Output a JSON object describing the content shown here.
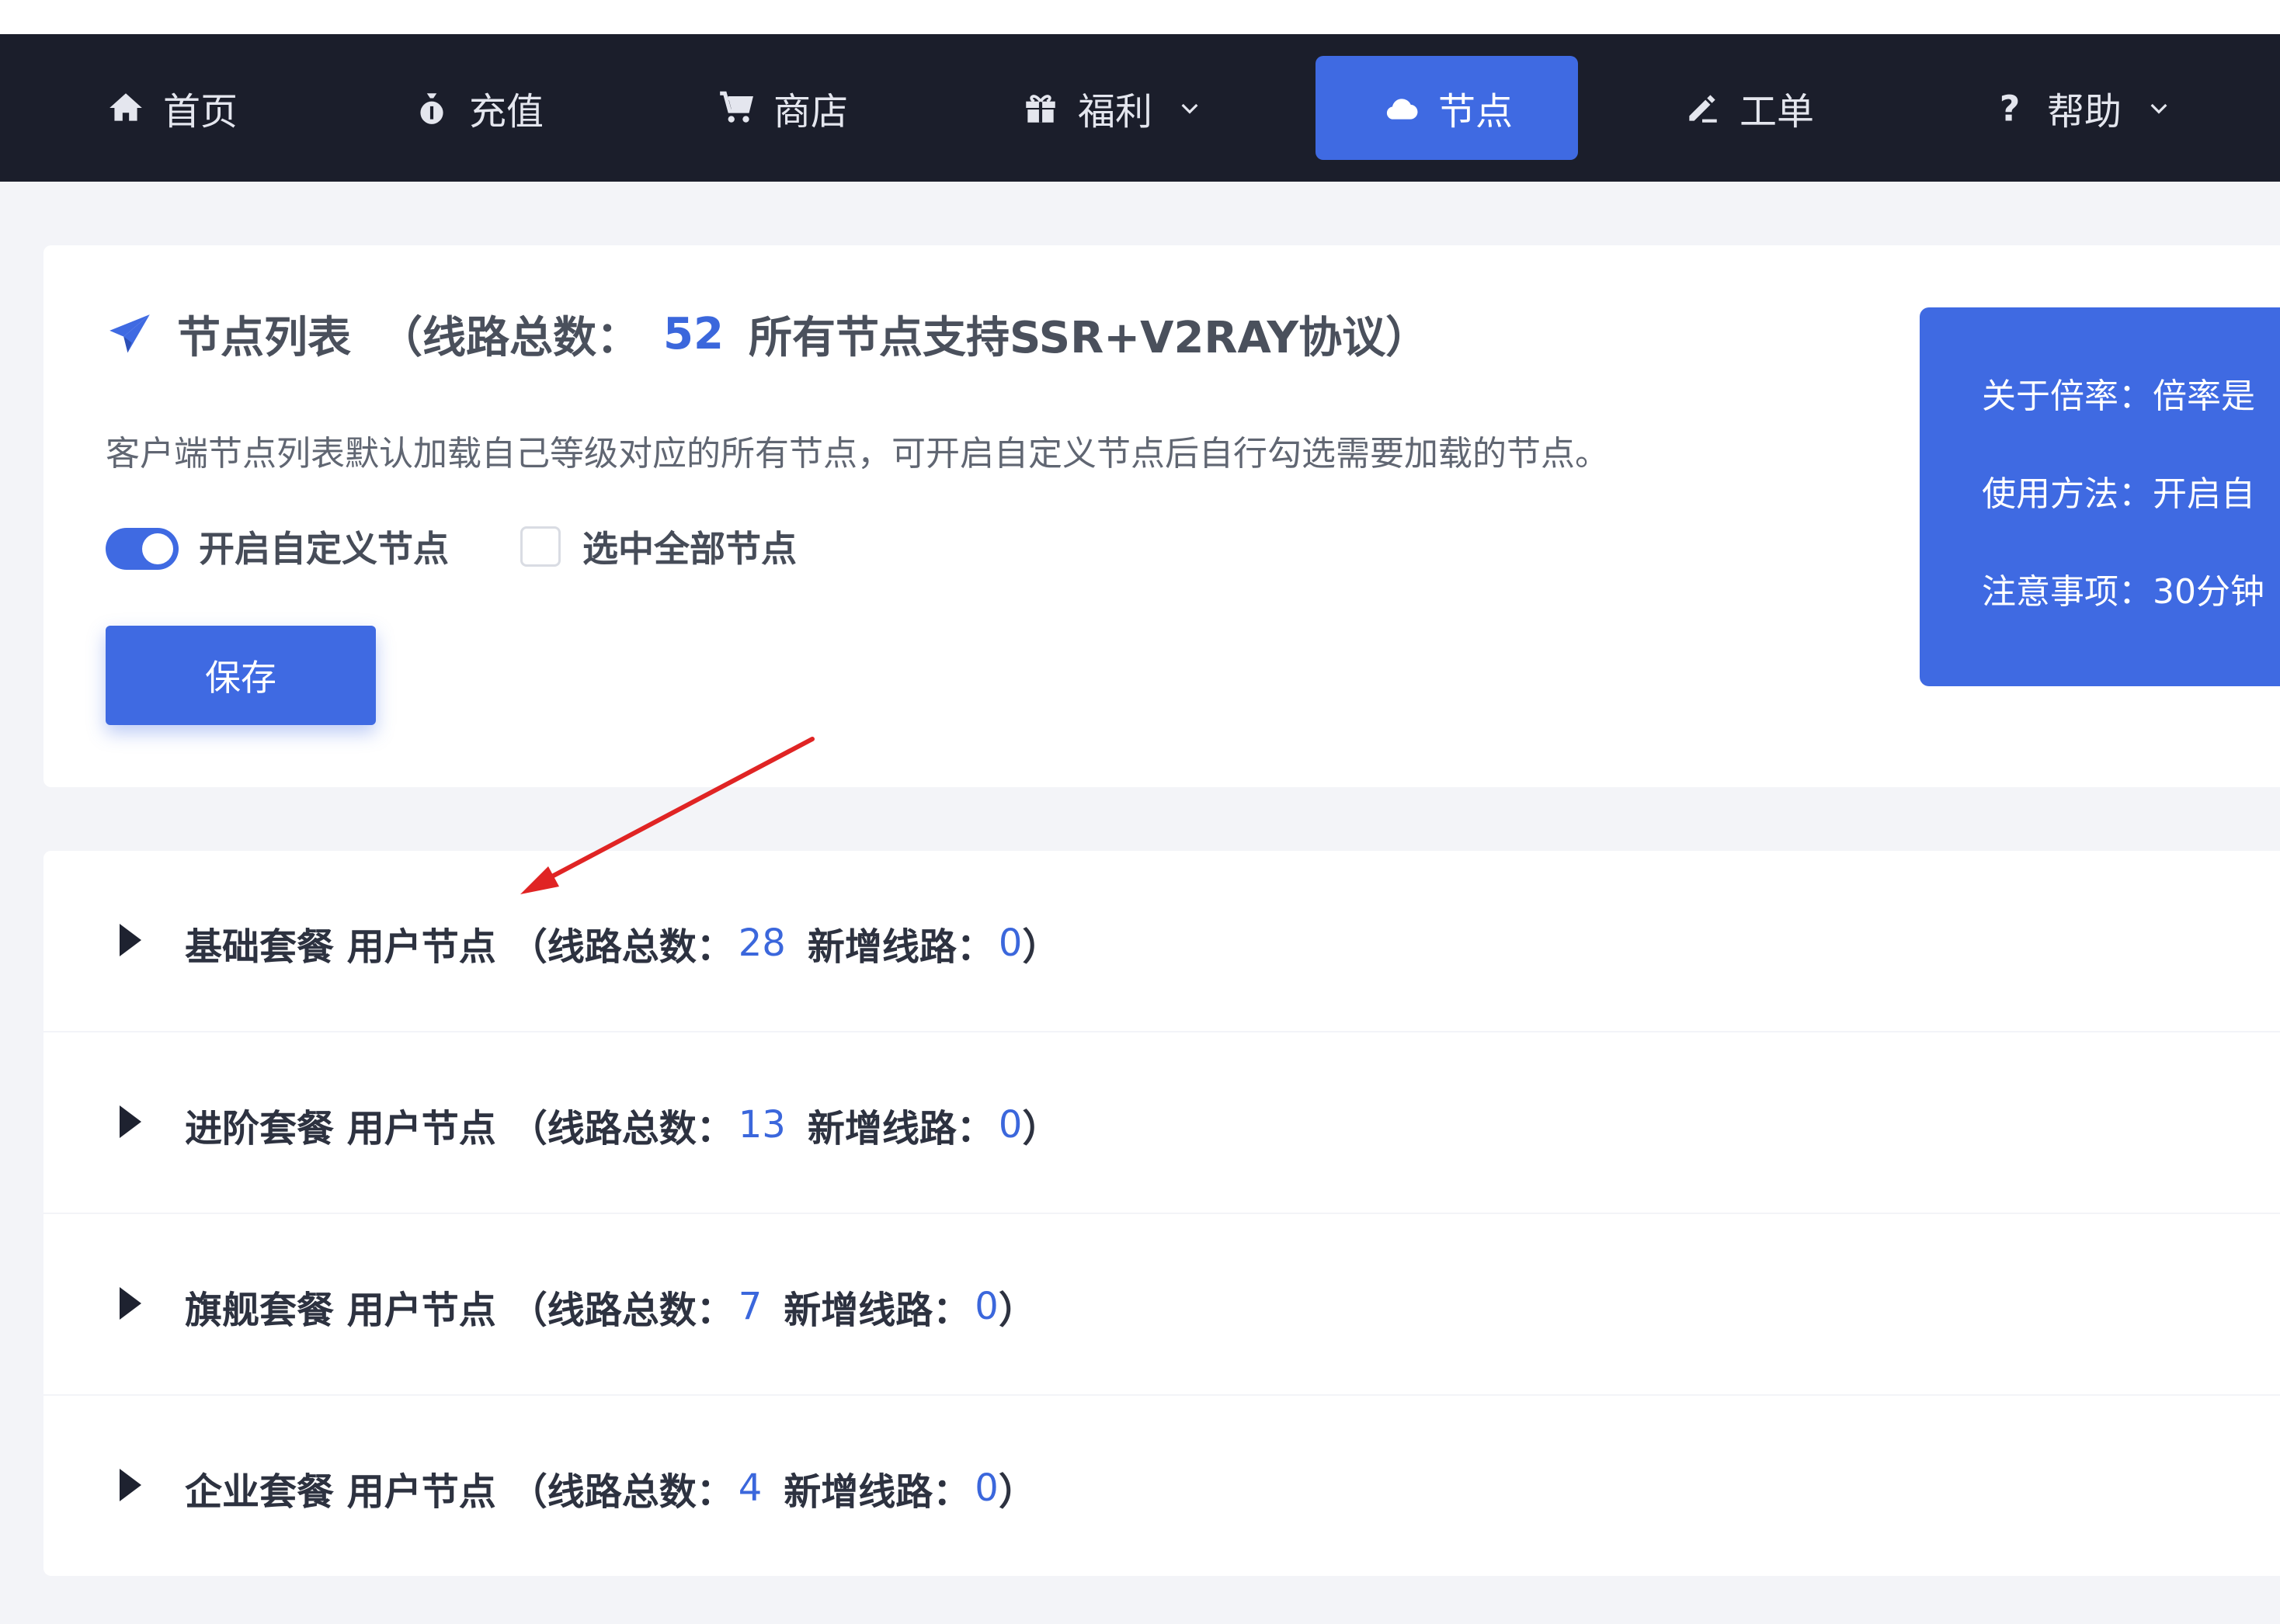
{
  "nav": {
    "items": [
      {
        "label": "首页",
        "icon": "home-icon"
      },
      {
        "label": "充值",
        "icon": "money-bag-icon"
      },
      {
        "label": "商店",
        "icon": "cart-icon"
      },
      {
        "label": "福利",
        "icon": "gift-icon",
        "has_dropdown": true
      },
      {
        "label": "节点",
        "icon": "cloud-icon",
        "active": true
      },
      {
        "label": "工单",
        "icon": "edit-icon"
      },
      {
        "label": "帮助",
        "icon": "question-icon",
        "has_dropdown": true
      }
    ]
  },
  "header": {
    "title": "节点列表",
    "total_prefix": "（线路总数：",
    "total": "52",
    "total_suffix": "所有节点支持SSR+V2RAY协议）",
    "description": "客户端节点列表默认加载自己等级对应的所有节点，可开启自定义节点后自行勾选需要加载的节点。"
  },
  "controls": {
    "custom_toggle_label": "开启自定义节点",
    "custom_toggle_on": true,
    "select_all_label": "选中全部节点",
    "select_all_checked": false,
    "save_label": "保存"
  },
  "info_panel": {
    "lines": [
      "关于倍率：倍率是",
      "使用方法：开启自",
      "注意事项：30分钟"
    ]
  },
  "groups": [
    {
      "name": "基础套餐 用户节点",
      "total_prefix": "（线路总数：",
      "total": "28",
      "new_label": "新增线路：",
      "new": "0",
      "close": "）"
    },
    {
      "name": "进阶套餐 用户节点",
      "total_prefix": "（线路总数：",
      "total": "13",
      "new_label": "新增线路：",
      "new": "0",
      "close": "）"
    },
    {
      "name": "旗舰套餐 用户节点",
      "total_prefix": "（线路总数：",
      "total": "7",
      "new_label": "新增线路：",
      "new": "0",
      "close": "）"
    },
    {
      "name": "企业套餐 用户节点",
      "total_prefix": "（线路总数：",
      "total": "4",
      "new_label": "新增线路：",
      "new": "0",
      "close": "）"
    }
  ],
  "colors": {
    "nav_bg": "#1b1e2b",
    "accent": "#3f6ae2",
    "number": "#3b67dc",
    "annotation_arrow": "#e02424"
  }
}
